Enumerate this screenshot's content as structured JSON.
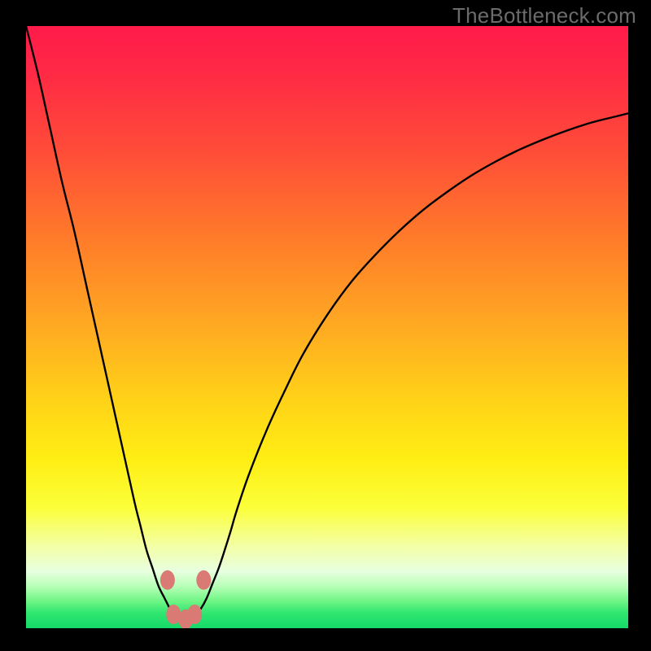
{
  "watermark": "TheBottleneck.com",
  "colors": {
    "frame": "#000000",
    "curve": "#000000",
    "marker_fill": "#d97a75",
    "marker_stroke": "#b35a55",
    "gradient_stops": [
      {
        "offset": 0.0,
        "color": "#ff1a4a"
      },
      {
        "offset": 0.08,
        "color": "#ff2a45"
      },
      {
        "offset": 0.2,
        "color": "#ff4a39"
      },
      {
        "offset": 0.35,
        "color": "#ff7a2a"
      },
      {
        "offset": 0.5,
        "color": "#ffaa22"
      },
      {
        "offset": 0.62,
        "color": "#ffd218"
      },
      {
        "offset": 0.72,
        "color": "#ffee14"
      },
      {
        "offset": 0.8,
        "color": "#fbff3a"
      },
      {
        "offset": 0.86,
        "color": "#f4ffa0"
      },
      {
        "offset": 0.905,
        "color": "#e8ffe0"
      },
      {
        "offset": 0.93,
        "color": "#b8ffb8"
      },
      {
        "offset": 0.955,
        "color": "#70f585"
      },
      {
        "offset": 0.975,
        "color": "#2fe670"
      },
      {
        "offset": 1.0,
        "color": "#16d968"
      }
    ]
  },
  "chart_data": {
    "type": "line",
    "title": "",
    "xlabel": "",
    "ylabel": "",
    "xlim": [
      0,
      100
    ],
    "ylim": [
      0,
      100
    ],
    "x": [
      0,
      2,
      4,
      6,
      8,
      10,
      12,
      14,
      16,
      18,
      19,
      20,
      21,
      22,
      23,
      24,
      24.5,
      25,
      25.5,
      26,
      26.5,
      27,
      27.5,
      28,
      29,
      30,
      31,
      32,
      33,
      34,
      35,
      37,
      40,
      43,
      46,
      50,
      54,
      58,
      62,
      66,
      70,
      74,
      78,
      82,
      86,
      90,
      94,
      98,
      100
    ],
    "y": [
      100,
      92,
      83,
      74,
      66,
      57,
      48,
      39,
      30,
      21,
      17,
      13,
      10,
      7,
      5,
      3,
      2.1,
      1.6,
      1.3,
      1.2,
      1.2,
      1.3,
      1.6,
      2.0,
      3.2,
      5.0,
      7.5,
      10.0,
      13.0,
      16.2,
      19.6,
      25.5,
      33.0,
      39.5,
      45.5,
      52.0,
      57.5,
      62.0,
      66.0,
      69.5,
      72.5,
      75.2,
      77.5,
      79.5,
      81.2,
      82.7,
      84.0,
      85.0,
      85.5
    ],
    "markers": [
      {
        "x": 23.5,
        "y": 8.0
      },
      {
        "x": 24.5,
        "y": 2.3
      },
      {
        "x": 26.5,
        "y": 1.5
      },
      {
        "x": 28.0,
        "y": 2.3
      },
      {
        "x": 29.5,
        "y": 8.0
      }
    ]
  }
}
